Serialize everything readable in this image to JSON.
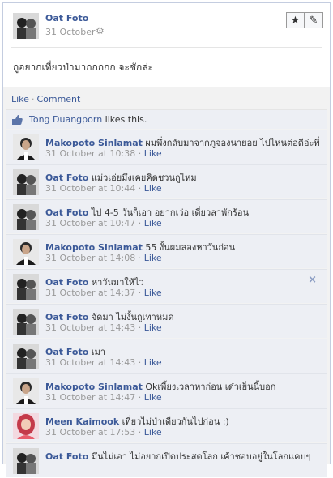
{
  "post": {
    "author": "Oat Foto",
    "date": "31 October",
    "text": "กูอยากเที่ยวป่ามากกกกก จะชักล่ะ",
    "buttons": {
      "star_icon": "star-icon",
      "edit_icon": "pencil-icon"
    }
  },
  "actions": {
    "like": "Like",
    "separator": "·",
    "comment": "Comment"
  },
  "likes": {
    "name": "Tong Duangporn",
    "suffix": " likes this."
  },
  "comments": [
    {
      "author": "Makopoto Sinlamat",
      "text": "ผมพึ่งกลับมาจากภูจองนายอย ไปไหนต่อดีอ่ะพี่",
      "time": "31 October at 10:38",
      "avatar": "male"
    },
    {
      "author": "Oat Foto",
      "text": "แม่วเอ่ยมึงเคยคิดชวนกูไหม",
      "time": "31 October at 10:44",
      "avatar": "couple"
    },
    {
      "author": "Oat Foto",
      "text": "ไป 4-5 วันก็เอา อยากเว่อ เดี๋ยวลาพักร้อน",
      "time": "31 October at 10:47",
      "avatar": "couple"
    },
    {
      "author": "Makopoto Sinlamat",
      "text": "55 งั้นผมลองหาวันก่อน",
      "time": "31 October at 14:08",
      "avatar": "male"
    },
    {
      "author": "Oat Foto",
      "text": "หาวันมาให้ไว",
      "time": "31 October at 14:37",
      "avatar": "couple",
      "close": "×"
    },
    {
      "author": "Oat Foto",
      "text": "จัดมา ไม่งั้นกูเทาหมด",
      "time": "31 October at 14:43",
      "avatar": "couple"
    },
    {
      "author": "Oat Foto",
      "text": "เมา",
      "time": "31 October at 14:43",
      "avatar": "couple"
    },
    {
      "author": "Makopoto Sinlamat",
      "text": "Okเพี้ยงเวลาหาก่อน เด๋วเย็นนี้บอก",
      "time": "31 October at 14:47",
      "avatar": "male"
    },
    {
      "author": "Meen Kaimook",
      "text": "เที่ยวไม่ป่าเดียวกันไปก่อน :)",
      "time": "31 October at 17:53",
      "avatar": "female"
    },
    {
      "author": "Oat Foto",
      "text": "มึนไม่เอา ไม่อยากเปิดประสดโลก เค้าชอบอยู่ในโลกแคบๆ",
      "time": "",
      "avatar": "couple"
    }
  ],
  "comment_like_label": "Like",
  "comment_meta_sep": " · ",
  "colors": {
    "link": "#3b5998",
    "muted": "#999999",
    "comment_bg": "#edeff4"
  }
}
